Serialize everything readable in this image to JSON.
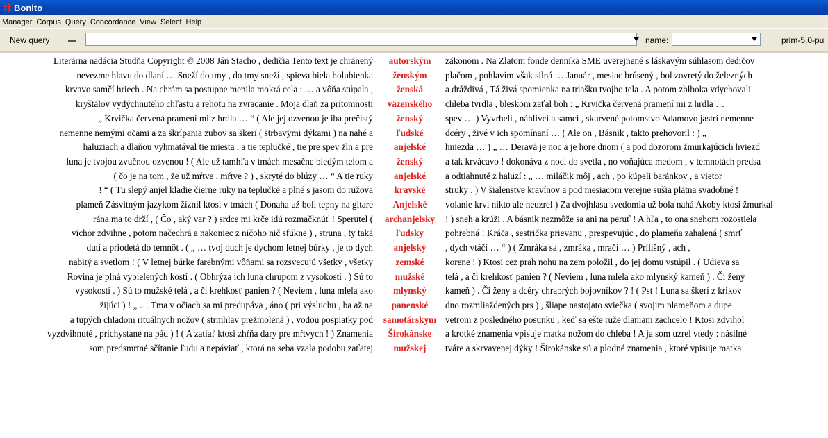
{
  "window": {
    "title": "Bonito"
  },
  "menu": [
    "Manager",
    "Corpus",
    "Query",
    "Concordance",
    "View",
    "Select",
    "Help"
  ],
  "toolbar": {
    "new_query_label": "New query",
    "query_value": "",
    "name_label": "name:",
    "name_value": "",
    "corpus_label": "prim-5.0-pu"
  },
  "colors": {
    "keyword": "#e0201c",
    "titlebar": "#0a4fc4",
    "chrome": "#ece9d8"
  },
  "concordance": [
    {
      "left": "Literárna nadácia Studňa Copyright © 2008 Ján Stacho , dedičia Tento text je chránený",
      "kw": "autorským",
      "right": "zákonom . Na Zlatom fonde denníka SME uverejnené s láskavým súhlasom dedičov"
    },
    {
      "left": "nevezme hlavu do dlaní … Sneží do tmy , do tmy sneží , spieva biela holubienka",
      "kw": "ženským",
      "right": "plačom , pohlavím však silná … Január , mesiac brúsený , bol zovretý do železných"
    },
    {
      "left": "krvavo samčí hriech . Na chrám sa postupne menila mokrá cela : … a vôňa stúpala ,",
      "kw": "ženská",
      "right": "a dráždivá , Tá živá spomienka na triašku tvojho tela . A potom zhlboka vdychovali"
    },
    {
      "left": "kryštálov vydýchnutého chľastu a rehotu na zvracanie . Moja dlaň za prítomnosti",
      "kw": "väzenského",
      "right": "chleba tvrdla , bleskom zaťal boh : „ Krvička červená pramení mi z hrdla …"
    },
    {
      "left": "„ Krvička červená pramení mi z hrdla … “ ( Ale jej ozvenou je iba prečistý",
      "kw": "ženský",
      "right": "spev … ) Vyvrheli , náhlivci a samci , skurvené potomstvo Adamovo jastrí nemenne"
    },
    {
      "left": "nemenne nemými očami a za škrípania zubov sa škerí ( štrbavými dýkami ) na nahé a",
      "kw": "ľudské",
      "right": "dcéry , živé v ich spomínaní … ( Ale on , Básnik , takto prehovoril : ) „"
    },
    {
      "left": "haluziach a dlaňou vyhmatával tie miesta , a tie teplučké , tie pre spev žln a pre",
      "kw": "anjelské",
      "right": "hniezda … ) „ … Deravá je noc a je hore dnom ( a pod dozorom žmurkajúcich hviezd"
    },
    {
      "left": "luna je tvojou zvučnou ozvenou ! ( Ale už tamhľa v tmách mesačne bledým telom a",
      "kw": "ženský",
      "right": "a tak krvácavo ! dokonáva z noci do svetla , no voňajúca medom , v temnotách predsa"
    },
    {
      "left": "( čo je na tom , že už mŕtve , mŕtve ? ) , skryté do blúzy … “ A tie ruky",
      "kw": "anjelské",
      "right": "a odtiahnuté z haluzí : „ … miláčik môj , ach , po kúpeli baránkov , a vietor"
    },
    {
      "left": "! “ ( Tu slepý anjel kladie čierne ruky na teplučké a plné s jasom do ružova",
      "kw": "kravské",
      "right": "struky . ) V šialenstve kravínov a pod mesiacom verejne sušia plátna svadobné !"
    },
    {
      "left": "plameň Zásvitným jazykom žíznil ktosi v tmách ( Donaha už boli tepny na gitare",
      "kw": "Anjelské",
      "right": "volanie krvi nikto ale neuzrel ) Za dvojhlasu svedomia už bola nahá Akoby ktosi žmurkal"
    },
    {
      "left": "rána ma to drží , ( Čo , aký var ? ) srdce mi krče idú rozmačknúť ! Sperutel (",
      "kw": "archanjelsky",
      "right": "! ) sneh a krúži . A básnik nezmôže sa ani na peruť ! A hľa , to ona snehom rozostiela"
    },
    {
      "left": "víchor zdvihne , potom načechrá a nakoniec z ničoho nič sfúkne ) , struna , ty taká",
      "kw": "ľudsky",
      "right": "pohrebná ! Kráča , sestrička prievanu , prespevujúc , do plameňa zahalená ( smrť"
    },
    {
      "left": "dutí a priodetá do temnôt . ( „ … tvoj duch je dychom letnej búrky , je to dych",
      "kw": "anjelský",
      "right": ", dych vtáčí … “ ) ( Zmráka sa , zmráka , mračí … ) Prílišný , ach ,"
    },
    {
      "left": "nabitý a svetlom ! ( V letnej búrke farebnými vôňami sa rozsvecujú všetky , všetky",
      "kw": "zemské",
      "right": "korene ! ) Ktosi cez prah nohu na zem položil , do jej domu vstúpil . ( Udieva sa"
    },
    {
      "left": "Rovina je plná vybielených kostí . ( Obhrýza ich luna chrupom z vysokostí . ) Sú to",
      "kw": "mužské",
      "right": "telá , a či krehkosť panien ? ( Neviem , luna mlela ako mlynský kameň ) . Či ženy"
    },
    {
      "left": "vysokostí . ) Sú to mužské telá , a či krehkosť panien ? ( Neviem , luna mlela ako",
      "kw": "mlynský",
      "right": "kameň ) . Či ženy a dcéry chrabrých bojovníkov ? ! ( Pst ! Luna sa škerí z krikov"
    },
    {
      "left": "žijúci ) ! „ … Tma v očiach sa mi predupáva , áno ( pri výsluchu , ba až na",
      "kw": "panenské",
      "right": "dno rozmliaždených prs ) , šliape nastojato sviečka ( svojim plameňom a dupe"
    },
    {
      "left": "a tupých chladom rituálnych nožov ( strmhlav prežmolená ) , vodou pospiatky pod",
      "kw": "samotárskym",
      "right": "vetrom z posledného posunku , keď sa ešte ruže dlaniam zachcelo ! Ktosi zdvihol"
    },
    {
      "left": "vyzdvihnuté , prichystané na pád ) ! ( A zatiaľ ktosi zhŕňa dary pre mŕtvych ! ) Znamenia",
      "kw": "Širokánske",
      "right": "a krotké znamenia vpisuje matka nožom do chleba ! A ja som uzrel vtedy : násilné"
    },
    {
      "left": "som predsmrtné sčítanie ľudu a nepáviať , ktorá na seba vzala podobu zaťatej",
      "kw": "mužskej",
      "right": "tváre a skrvavenej dýky ! Širokánske sú a plodné znamenia , ktoré vpisuje matka"
    }
  ]
}
